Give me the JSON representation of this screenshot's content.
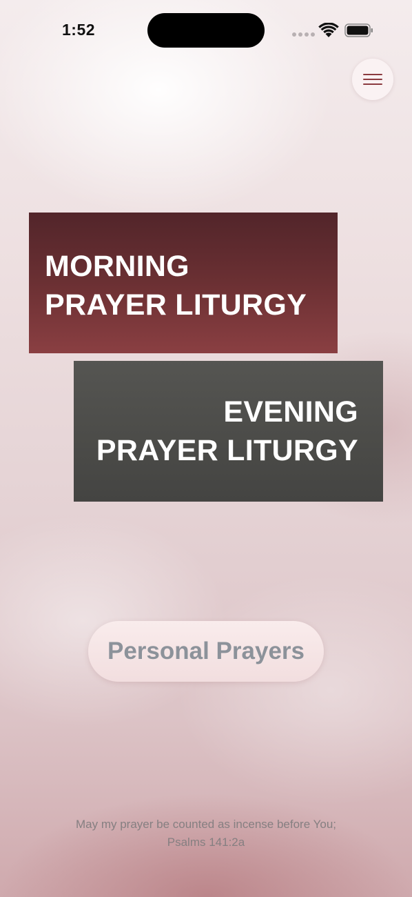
{
  "status_bar": {
    "time": "1:52",
    "icons": [
      "signal-dots-icon",
      "wifi-icon",
      "battery-icon"
    ]
  },
  "menu": {
    "icon": "hamburger-icon",
    "color": "#8b3a3f"
  },
  "cards": {
    "morning": {
      "line1": "MORNING",
      "line2": "PRAYER LITURGY",
      "color_top": "#52252a",
      "color_bottom": "#8a3f42"
    },
    "evening": {
      "line1": "EVENING",
      "line2": "PRAYER LITURGY",
      "color_top": "#555552",
      "color_bottom": "#444442"
    }
  },
  "personal_prayers": {
    "label": "Personal Prayers"
  },
  "verse": {
    "text": "May my prayer be counted as incense before You;",
    "reference": "Psalms 141:2a"
  }
}
